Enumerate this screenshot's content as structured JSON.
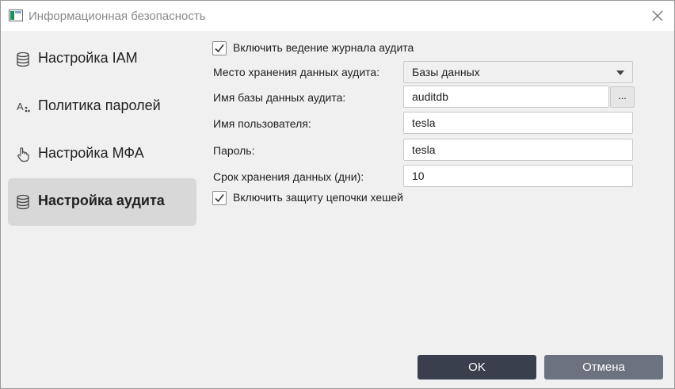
{
  "window": {
    "title": "Информационная безопасность"
  },
  "sidebar": {
    "items": [
      {
        "label": "Настройка IAM",
        "icon": "database-icon",
        "active": false
      },
      {
        "label": "Политика паролей",
        "icon": "password-policy-icon",
        "active": false
      },
      {
        "label": "Настройка МФА",
        "icon": "hand-pointer-icon",
        "active": false
      },
      {
        "label": "Настройка аудита",
        "icon": "database-icon",
        "active": true
      }
    ]
  },
  "audit": {
    "enable_log_label": "Включить ведение журнала аудита",
    "enable_log_checked": true,
    "storage_label": "Место хранения данных аудита:",
    "storage_value": "Базы данных",
    "db_name_label": "Имя базы данных аудита:",
    "db_name_value": "auditdb",
    "browse_label": "...",
    "username_label": "Имя пользователя:",
    "username_value": "tesla",
    "password_label": "Пароль:",
    "password_value": "tesla",
    "retention_label": "Срок хранения данных (дни):",
    "retention_value": "10",
    "hash_chain_label": "Включить защиту цепочки хешей",
    "hash_chain_checked": true
  },
  "footer": {
    "ok_label": "OK",
    "cancel_label": "Отмена"
  }
}
